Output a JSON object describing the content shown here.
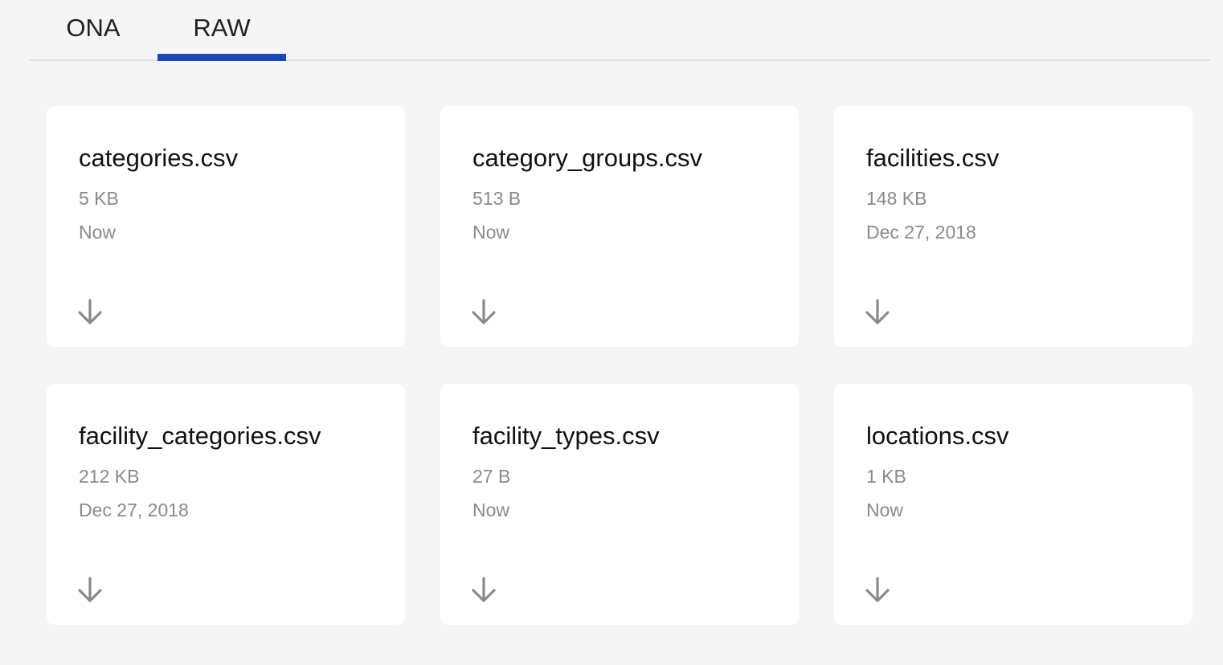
{
  "tabs": [
    {
      "label": "ONA",
      "active": false
    },
    {
      "label": "RAW",
      "active": true
    }
  ],
  "accent_color": "#1a46b8",
  "files": [
    {
      "name": "categories.csv",
      "size": "5 KB",
      "date": "Now",
      "icon": "download-icon"
    },
    {
      "name": "category_groups.csv",
      "size": "513 B",
      "date": "Now",
      "icon": "download-icon"
    },
    {
      "name": "facilities.csv",
      "size": "148 KB",
      "date": "Dec 27, 2018",
      "icon": "download-icon"
    },
    {
      "name": "facility_categories.csv",
      "size": "212 KB",
      "date": "Dec 27, 2018",
      "icon": "download-icon"
    },
    {
      "name": "facility_types.csv",
      "size": "27 B",
      "date": "Now",
      "icon": "download-icon"
    },
    {
      "name": "locations.csv",
      "size": "1 KB",
      "date": "Now",
      "icon": "download-icon"
    }
  ]
}
